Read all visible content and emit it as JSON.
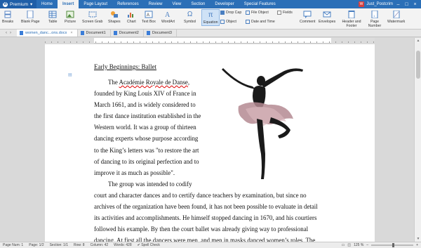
{
  "menubar": {
    "app_label": "Premium",
    "tabs": [
      "Home",
      "Insert",
      "Page Layout",
      "References",
      "Review",
      "View",
      "Section",
      "Developer",
      "Special Features"
    ],
    "active_tab": "Insert",
    "user": "Just_Postcrim"
  },
  "ribbon": {
    "breaks": "Breaks",
    "blank_page": "Blank Page",
    "table": "Table",
    "picture": "Picture",
    "screen_grab": "Screen Grab",
    "shapes": "Shapes",
    "chart": "Chart",
    "text_box": "Text Box",
    "wordart": "WordArt",
    "symbol": "Symbol",
    "equation": "Equation",
    "drop_cap": "Drop Cap",
    "file_object": "File Object",
    "fields": "Fields",
    "object": "Object",
    "date_time": "Date and Time",
    "comment": "Comment",
    "envelopes": "Envelopes",
    "header_footer": "Header and Footer",
    "page_number": "Page Number",
    "watermark": "Watermark"
  },
  "doc_tabs": [
    {
      "label": "women_danc...ons.docx",
      "active": true
    },
    {
      "label": "Document1",
      "active": false
    },
    {
      "label": "Document2",
      "active": false
    },
    {
      "label": "Document3",
      "active": false
    }
  ],
  "document": {
    "title": "Early Beginnings: Ballet",
    "para1_lines": [
      "The Académie Royale de Danse,",
      "founded by King Louis XIV of France in",
      "March 1661, and is widely considered to",
      "the first dance institution established in the",
      "Western world. It was a group of thirteen",
      "dancing experts whose purpose according",
      "to the King’s letters was \"to restore the art",
      "of dancing to its original perfection and to",
      "improve it as much as possible\"."
    ],
    "para2_lines": [
      "The group was intended to codify",
      "court and character dances and to certify dance teachers by examination, but since no",
      "archives of the organization have been found, it has not been possible to evaluate in detail",
      "its activities and accomplishments. He himself stopped dancing in 1670, and his courtiers",
      "followed his example. By then the court ballet was already giving way to professional",
      "dancing. At first all the dancers were men, and men in masks danced women’s roles. The"
    ]
  },
  "statusbar": {
    "page_num": "Page Num: 1",
    "page": "Page: 1/2",
    "section": "Section: 1/1",
    "row": "Row: 8",
    "column": "Column: 42",
    "words": "Words: 428",
    "spell_check": "Spell Check",
    "zoom": "125 %"
  },
  "colors": {
    "menubar": "#2b6fb7",
    "ribbon": "#f3f3f3",
    "page": "#ffffff"
  }
}
